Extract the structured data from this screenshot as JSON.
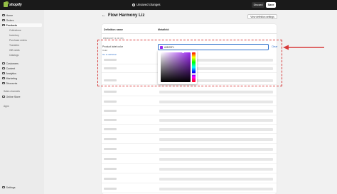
{
  "topbar": {
    "logo_text": "shopify",
    "unsaved_label": "Unsaved changes",
    "discard_label": "Discard",
    "save_label": "Save"
  },
  "sidebar": {
    "items": [
      {
        "label": "Home"
      },
      {
        "label": "Orders"
      },
      {
        "label": "Products"
      },
      {
        "label": "Customers"
      },
      {
        "label": "Content"
      },
      {
        "label": "Analytics"
      },
      {
        "label": "Marketing"
      },
      {
        "label": "Discounts"
      }
    ],
    "sub_items": [
      {
        "label": "Collections"
      },
      {
        "label": "Inventory"
      },
      {
        "label": "Purchase orders"
      },
      {
        "label": "Transfers"
      },
      {
        "label": "Gift cards"
      },
      {
        "label": "Catalogs"
      }
    ],
    "sales_channels_label": "Sales channels",
    "online_store_label": "Online Store",
    "apps_label": "Apps",
    "settings_label": "Settings"
  },
  "main": {
    "title": "Flow Harmony Liz",
    "view_definition_label": "View definition settings",
    "col_definition": "Definition name",
    "col_metafield": "Metafield",
    "product_count": "PRODUCT (1 OF 15)"
  },
  "field": {
    "label": "Product label color",
    "sub": "Color",
    "link": "Go to definition",
    "hex_value": "#9D29F1",
    "clear_label": "Clear"
  },
  "colors": {
    "accent": "#2c6ecb",
    "highlight": "#d73a3a",
    "selected_color": "#9d29f1"
  }
}
